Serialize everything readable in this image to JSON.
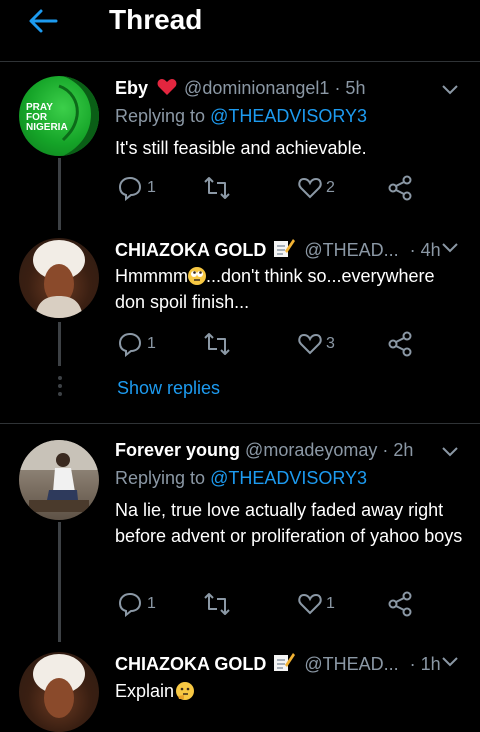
{
  "header": {
    "title": "Thread",
    "back_icon": "arrow-left-icon",
    "accent": "#1d9bf0"
  },
  "tweets": [
    {
      "name": "Eby",
      "name_suffix_icon": "red-heart-emoji",
      "handle": "@dominionangel1",
      "time": "· 5h",
      "replying_prefix": "Replying to",
      "replying_to": "@THEADVISORY3",
      "text": "It's still feasible and achievable.",
      "avatar_text": [
        "PRAY",
        "FOR",
        "NIGERIA"
      ],
      "reply_count": "1",
      "like_count": "2"
    },
    {
      "name": "CHIAZOKA GOLD",
      "name_suffix_icon": "memo-emoji",
      "handle": "@THEAD...",
      "time": "· 4h",
      "text_line1_a": "Hmmmm",
      "text_line1_b": "...don't think so...everywhere",
      "text_line2": "don spoil finish...",
      "reply_count": "1",
      "like_count": "3",
      "show_replies": "Show replies"
    },
    {
      "name": "Forever young",
      "handle": "@moradeyomay",
      "time": "· 2h",
      "replying_prefix": "Replying to",
      "replying_to": "@THEADVISORY3",
      "text": "Na lie, true love actually faded away right before advent or proliferation of yahoo boys",
      "reply_count": "1",
      "like_count": "1"
    },
    {
      "name": "CHIAZOKA GOLD",
      "name_suffix_icon": "memo-emoji",
      "handle": "@THEAD...",
      "time": "· 1h",
      "text": "Explain",
      "text_suffix_icon": "thinking-face-emoji"
    }
  ]
}
